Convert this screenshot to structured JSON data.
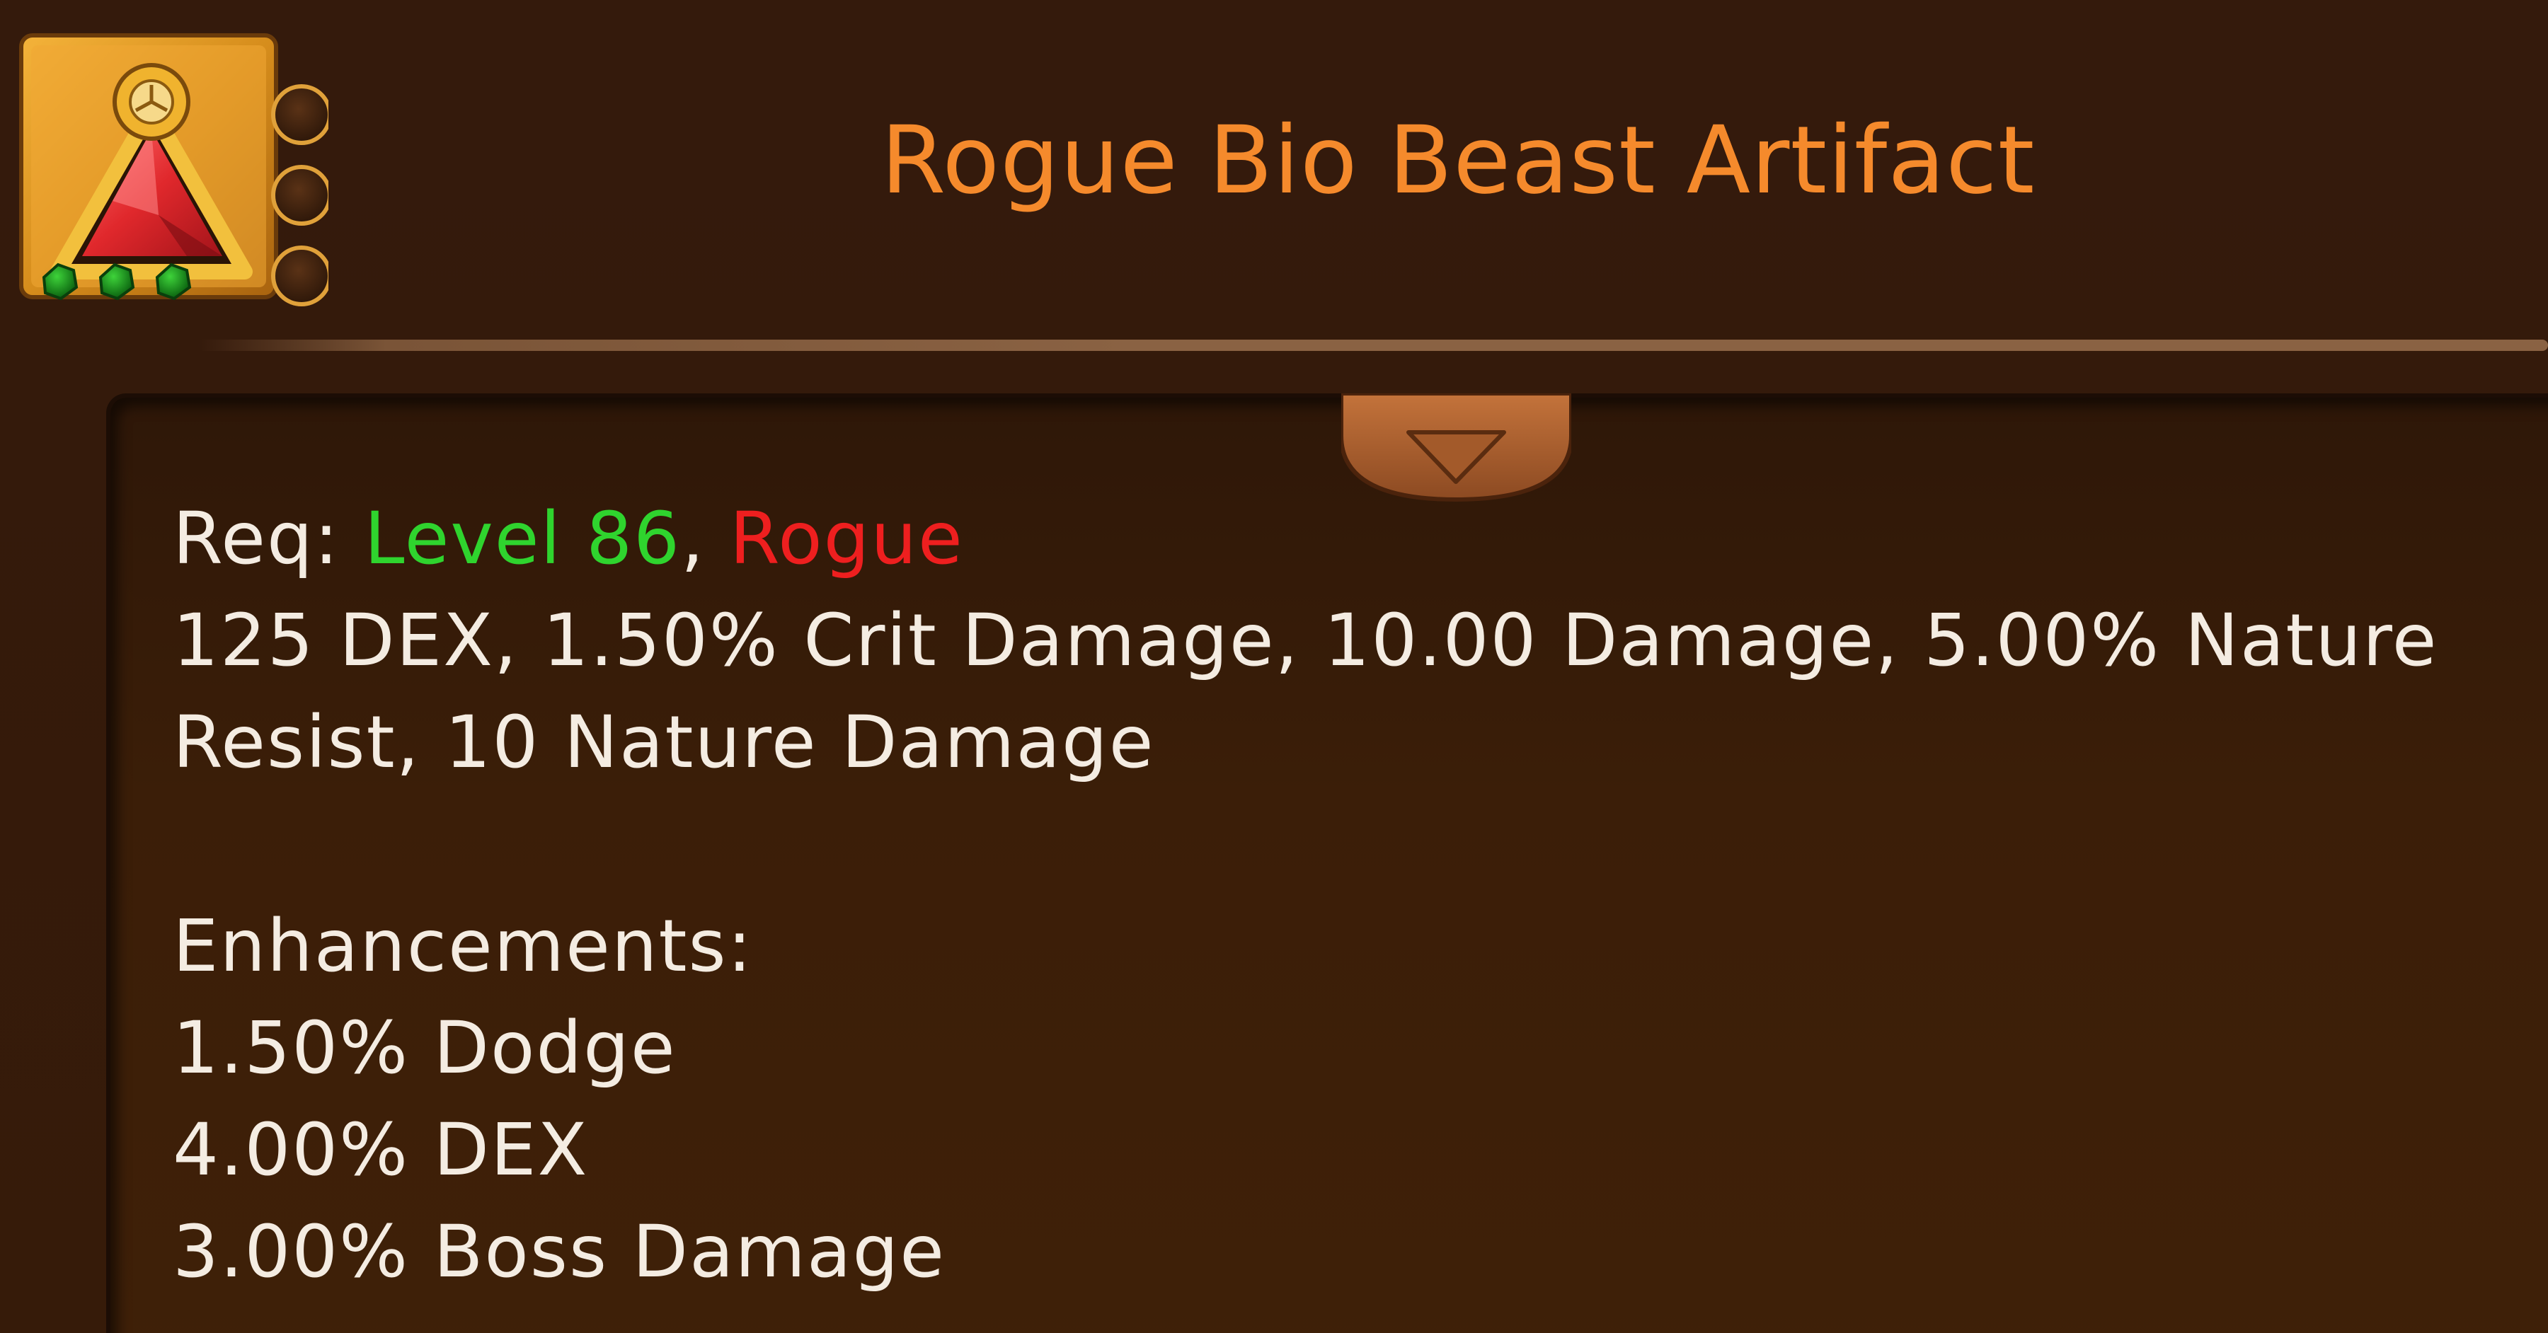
{
  "item": {
    "title": "Rogue Bio Beast Artifact",
    "icon": "red-triangle-artifact-icon",
    "sockets_filled": 3,
    "upgrade_slots": 3
  },
  "requirements": {
    "prefix": "Req: ",
    "level": "Level 86",
    "separator": ", ",
    "class": "Rogue"
  },
  "stats": {
    "line1": "125 DEX, 1.50% Crit Damage, 10.00 Damage, 5.00% Nature",
    "line2": "Resist, 10 Nature Damage"
  },
  "enhancements": {
    "heading": "Enhancements:",
    "items": [
      "1.50% Dodge",
      "4.00% DEX",
      "3.00% Boss Damage"
    ]
  },
  "colors": {
    "title": "#f58a2c",
    "level": "#2fd42e",
    "class": "#ee1f1f",
    "text": "#f4ece2"
  }
}
